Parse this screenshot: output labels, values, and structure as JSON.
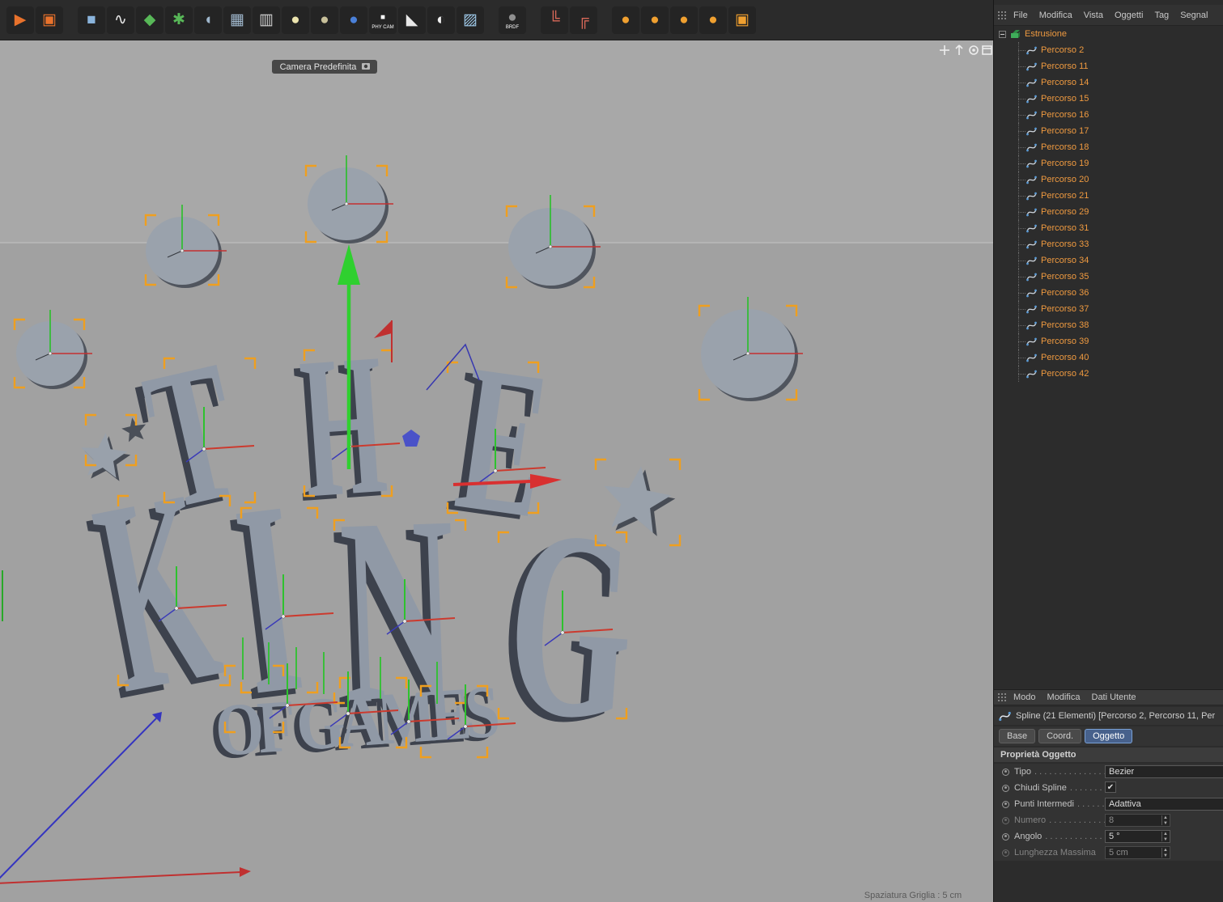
{
  "toolbar": {
    "icons": [
      {
        "name": "render-view-icon",
        "glyph": "▶",
        "color": "#e8722c"
      },
      {
        "name": "render-settings-icon",
        "glyph": "▣",
        "color": "#e8722c"
      },
      {
        "name": "cube-primitive-icon",
        "glyph": "■",
        "color": "#8ab4dc",
        "gap": true
      },
      {
        "name": "spline-pen-icon",
        "glyph": "∿",
        "color": "#e8e8e8"
      },
      {
        "name": "extrude-generator-icon",
        "glyph": "◆",
        "color": "#58b858"
      },
      {
        "name": "array-generator-icon",
        "glyph": "✱",
        "color": "#58b858"
      },
      {
        "name": "deformer-icon",
        "glyph": "◖",
        "color": "#9fb7cc"
      },
      {
        "name": "plane-grid-icon",
        "glyph": "▦",
        "color": "#9fb7cc"
      },
      {
        "name": "camera-object-icon",
        "glyph": "▥",
        "color": "#cfcfcf"
      },
      {
        "name": "light-object-icon",
        "glyph": "●",
        "color": "#ece4ae"
      },
      {
        "name": "target-light-icon",
        "glyph": "●",
        "color": "#c8c09a"
      },
      {
        "name": "sky-object-icon",
        "glyph": "●",
        "color": "#4a80d8"
      },
      {
        "name": "physical-camera-icon",
        "glyph": "▪",
        "color": "#ffffff",
        "label": "PHY CAM"
      },
      {
        "name": "floor-object-icon",
        "glyph": "◣",
        "color": "#e8e8e8"
      },
      {
        "name": "gradient-shader-icon",
        "glyph": "◐",
        "color": "#f0f0f0"
      },
      {
        "name": "sky-texture-icon",
        "glyph": "▨",
        "color": "#9ec8e8"
      },
      {
        "name": "brdf-material-icon",
        "glyph": "●",
        "color": "#8f8f8f",
        "label": "BRDF",
        "gap": true
      },
      {
        "name": "ik-joint-icon",
        "glyph": "╚",
        "color": "#d86858",
        "gap": true
      },
      {
        "name": "ik-chain-icon",
        "glyph": "╔",
        "color": "#d86858"
      },
      {
        "name": "material-sphere-1-icon",
        "glyph": "●",
        "color": "#f0a030",
        "gap": true
      },
      {
        "name": "material-sphere-2-icon",
        "glyph": "●",
        "color": "#f0a030"
      },
      {
        "name": "material-sphere-3-icon",
        "glyph": "●",
        "color": "#f0a030"
      },
      {
        "name": "material-sphere-4-icon",
        "glyph": "●",
        "color": "#f0a030"
      },
      {
        "name": "texture-tag-icon",
        "glyph": "▣",
        "color": "#f0a030"
      }
    ]
  },
  "viewport": {
    "camera_label": "Camera Predefinita",
    "grid_label": "Spaziatura Griglia : 5 cm",
    "letters": [
      "T",
      "H",
      "E",
      "K",
      "I",
      "N",
      "G",
      "OF GAMES"
    ]
  },
  "right_panel": {
    "menu": [
      "File",
      "Modifica",
      "Vista",
      "Oggetti",
      "Tag",
      "Segnal"
    ],
    "tree_root": "Estrusione",
    "tree_children": [
      "Percorso 2",
      "Percorso 11",
      "Percorso 14",
      "Percorso 15",
      "Percorso 16",
      "Percorso 17",
      "Percorso 18",
      "Percorso 19",
      "Percorso 20",
      "Percorso 21",
      "Percorso 29",
      "Percorso 31",
      "Percorso 33",
      "Percorso 34",
      "Percorso 35",
      "Percorso 36",
      "Percorso 37",
      "Percorso 38",
      "Percorso 39",
      "Percorso 40",
      "Percorso 42"
    ],
    "attribute_manager": {
      "menu": [
        "Modo",
        "Modifica",
        "Dati Utente"
      ],
      "selection": "Spline (21 Elementi) [Percorso 2, Percorso 11, Per",
      "tabs": [
        "Base",
        "Coord.",
        "Oggetto"
      ],
      "active_tab": "Oggetto",
      "section": "Proprietà Oggetto",
      "properties": [
        {
          "label": "Tipo",
          "leader": ". . . . . . . . . . . . . . .",
          "value": "Bezier",
          "control": "dropdown",
          "enabled": true
        },
        {
          "label": "Chiudi Spline",
          "leader": ". . . . . . . .",
          "value": "✔",
          "control": "checkbox",
          "enabled": true
        },
        {
          "label": "Punti Intermedi",
          "leader": ". . . . . .",
          "value": "Adattiva",
          "control": "dropdown",
          "enabled": true
        },
        {
          "label": "Numero",
          "leader": ". . . . . . . . . . . .",
          "value": "8",
          "control": "spinner",
          "enabled": false
        },
        {
          "label": "Angolo",
          "leader": ". . . . . . . . . . . .",
          "value": "5 °",
          "control": "spinner",
          "enabled": true
        },
        {
          "label": "Lunghezza Massima",
          "leader": "",
          "value": "5 cm",
          "control": "spinner",
          "enabled": false
        }
      ]
    }
  }
}
